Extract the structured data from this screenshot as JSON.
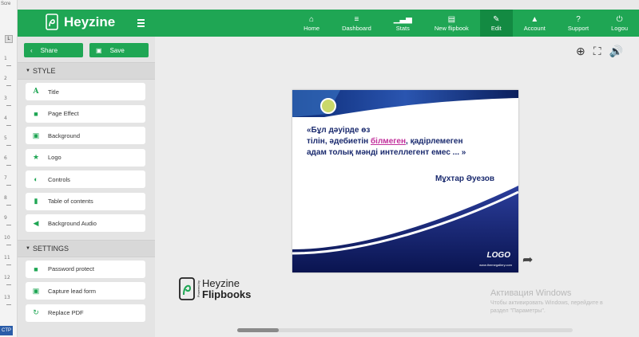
{
  "ruler": {
    "top_label": "Scre",
    "bottom_label": "CTP",
    "marker": "L",
    "numbers": [
      "1",
      "2",
      "3",
      "4",
      "5",
      "6",
      "7",
      "8",
      "9",
      "10",
      "11",
      "12",
      "13"
    ]
  },
  "brand": {
    "name": "Heyzine"
  },
  "nav": [
    {
      "icon": "home-icon",
      "glyph": "⌂",
      "label": "Home"
    },
    {
      "icon": "dashboard-icon",
      "glyph": "≡",
      "label": "Dashboard"
    },
    {
      "icon": "stats-icon",
      "glyph": "▁▃▅",
      "label": "Stats"
    },
    {
      "icon": "new-flipbook-icon",
      "glyph": "▤",
      "label": "New flipbook"
    },
    {
      "icon": "edit-icon",
      "glyph": "✎",
      "label": "Edit"
    },
    {
      "icon": "account-icon",
      "glyph": "▲",
      "label": "Account"
    },
    {
      "icon": "support-icon",
      "glyph": "?",
      "label": "Support"
    },
    {
      "icon": "logout-icon",
      "glyph": "⏻",
      "label": "Logou"
    }
  ],
  "sidebar": {
    "share_label": "Share",
    "save_label": "Save",
    "style_section": "STYLE",
    "style_items": [
      {
        "icon": "title-icon",
        "glyph": "A",
        "label": "Title"
      },
      {
        "icon": "page-effect-icon",
        "glyph": "■",
        "label": "Page Effect"
      },
      {
        "icon": "background-icon",
        "glyph": "▣",
        "label": "Background"
      },
      {
        "icon": "star-icon",
        "glyph": "★",
        "label": "Logo"
      },
      {
        "icon": "toggle-icon",
        "glyph": "◐",
        "label": "Controls"
      },
      {
        "icon": "bookmark-icon",
        "glyph": "▮",
        "label": "Table of contents"
      },
      {
        "icon": "audio-icon",
        "glyph": "◀",
        "label": "Background Audio"
      }
    ],
    "settings_section": "SETTINGS",
    "settings_items": [
      {
        "icon": "lock-icon",
        "glyph": "■",
        "label": "Password protect"
      },
      {
        "icon": "lead-form-icon",
        "glyph": "▣",
        "label": "Capture lead form"
      },
      {
        "icon": "replace-icon",
        "glyph": "↻",
        "label": "Replace PDF"
      }
    ]
  },
  "slide": {
    "line1": "«Бұл дәуірде өз",
    "line2_pre": "тілін, әдебиетін ",
    "line2_hl": "білмеген",
    "line2_post": ", қадірлемеген",
    "line3": "адам толық мәнді интеллегент емес ... »",
    "author": "Мұхтар Әуезов",
    "logo": "LOGO",
    "logo_sub": "www.themegallery.com"
  },
  "footer_logo": {
    "powered": "Powered by",
    "line1": "Heyzine",
    "line2": "Flipbooks"
  },
  "watermark": {
    "title": "Активация Windows",
    "line1": "Чтобы активировать Windows, перейдите в",
    "line2": "раздел \"Параметры\"."
  }
}
